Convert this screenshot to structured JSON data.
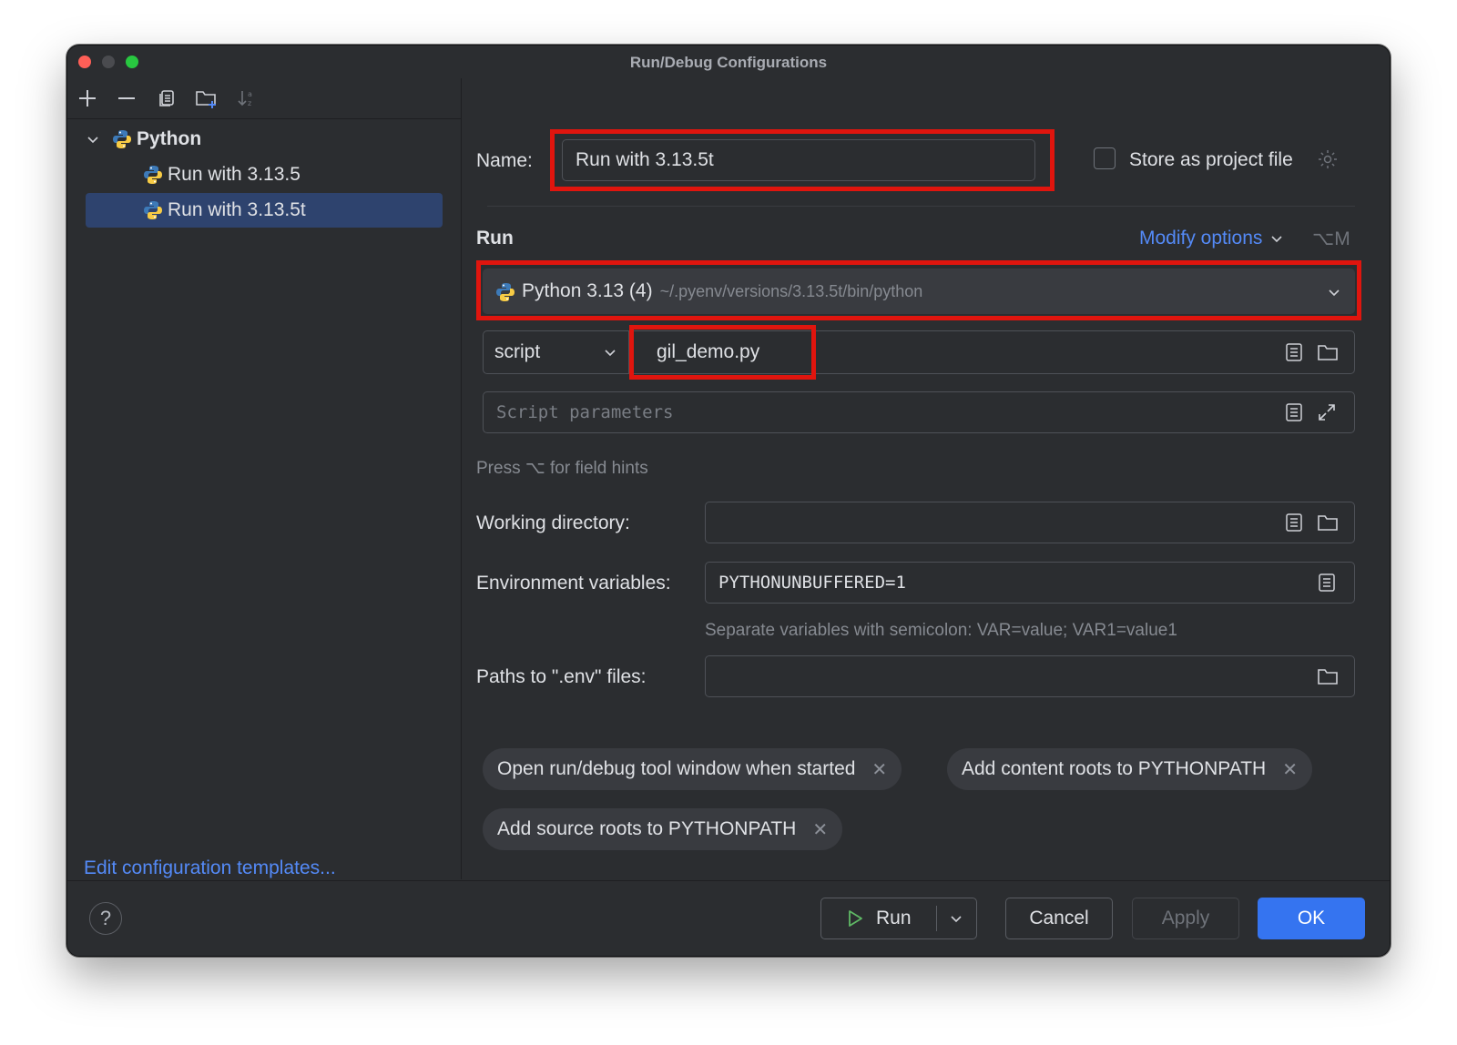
{
  "window": {
    "title": "Run/Debug Configurations"
  },
  "tree": {
    "group_label": "Python",
    "items": [
      {
        "label": "Run with 3.13.5"
      },
      {
        "label": "Run with 3.13.5t"
      }
    ]
  },
  "edit_templates_link": "Edit configuration templates...",
  "form": {
    "name_label": "Name:",
    "name_value": "Run with 3.13.5t",
    "store_label": "Store as project file",
    "run_section_label": "Run",
    "modify_options_label": "Modify options",
    "modify_options_shortcut": "⌥M",
    "interpreter_name": "Python 3.13 (4)",
    "interpreter_path": "~/.pyenv/versions/3.13.5t/bin/python",
    "target_type": "script",
    "script_value": "gil_demo.py",
    "script_params_placeholder": "Script parameters",
    "field_hint": "Press ⌥ for field hints",
    "working_dir_label": "Working directory:",
    "working_dir_value": "",
    "env_label": "Environment variables:",
    "env_value": "PYTHONUNBUFFERED=1",
    "env_hint": "Separate variables with semicolon: VAR=value; VAR1=value1",
    "dotenv_label": "Paths to \".env\" files:",
    "dotenv_value": ""
  },
  "chips": [
    {
      "label": "Open run/debug tool window when started"
    },
    {
      "label": "Add content roots to PYTHONPATH"
    },
    {
      "label": "Add source roots to PYTHONPATH"
    }
  ],
  "buttons": {
    "help": "?",
    "run": "Run",
    "cancel": "Cancel",
    "apply": "Apply",
    "ok": "OK"
  },
  "colors": {
    "accent": "#3574f0",
    "link": "#548af7",
    "highlight_box": "#e0150e",
    "selection": "#2e436e"
  },
  "icons": [
    "add-icon",
    "remove-icon",
    "copy-icon",
    "new-folder-icon",
    "sort-icon",
    "python-icon",
    "chevron-down-icon",
    "gear-icon",
    "list-icon",
    "folder-icon",
    "expand-icon",
    "close-icon",
    "play-icon",
    "help-icon"
  ]
}
